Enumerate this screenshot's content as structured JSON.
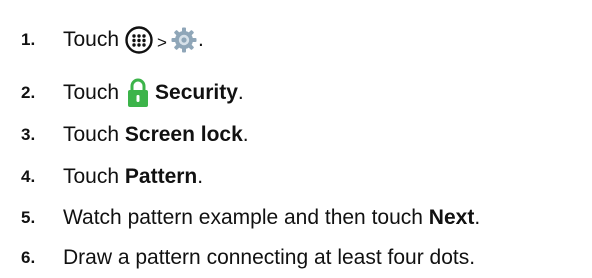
{
  "steps": [
    {
      "number": "1.",
      "text_before": "Touch",
      "icon1": "apps-grid-icon",
      "separator": ">",
      "icon2": "settings-gear-icon",
      "text_after": "."
    },
    {
      "number": "2.",
      "text_before": "Touch",
      "icon": "lock-icon",
      "bold": "Security",
      "text_after": "."
    },
    {
      "number": "3.",
      "text_before": "Touch",
      "bold": "Screen lock",
      "text_after": "."
    },
    {
      "number": "4.",
      "text_before": "Touch",
      "bold": "Pattern",
      "text_after": "."
    },
    {
      "number": "5.",
      "text_before": "Watch pattern example and then touch",
      "bold": "Next",
      "text_after": "."
    },
    {
      "number": "6.",
      "text": "Draw a pattern connecting at least four dots."
    }
  ],
  "colors": {
    "text": "#111111",
    "lock_icon": "#3cb44a",
    "gear_icon": "#8fa6b8"
  }
}
